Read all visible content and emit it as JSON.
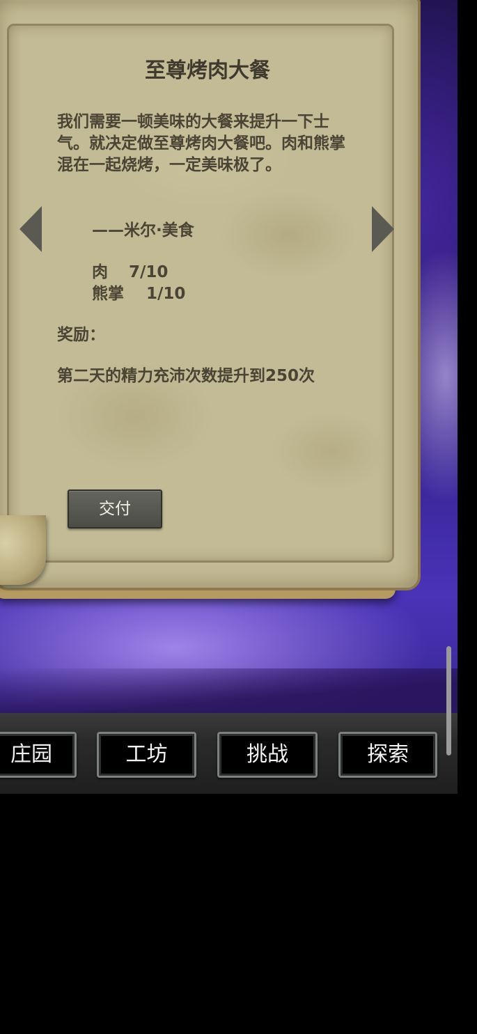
{
  "quest": {
    "title": "至尊烤肉大餐",
    "description": "我们需要一顿美味的大餐来提升一下士气。就决定做至尊烤肉大餐吧。肉和熊掌混在一起烧烤，一定美味极了。",
    "signature": "——米尔·美食",
    "requirements": [
      {
        "item": "肉",
        "progress": "7/10"
      },
      {
        "item": "熊掌",
        "progress": "1/10"
      }
    ],
    "reward_label": "奖励：",
    "reward_text": "第二天的精力充沛次数提升到250次",
    "submit_label": "交付"
  },
  "nav": {
    "items": [
      {
        "label": "庄园"
      },
      {
        "label": "工坊"
      },
      {
        "label": "挑战"
      },
      {
        "label": "探索"
      }
    ]
  },
  "colors": {
    "parchment": "#c3bb95",
    "text": "#4a4435",
    "button": "#5a5b53",
    "background_purple": "#4a33b8"
  }
}
